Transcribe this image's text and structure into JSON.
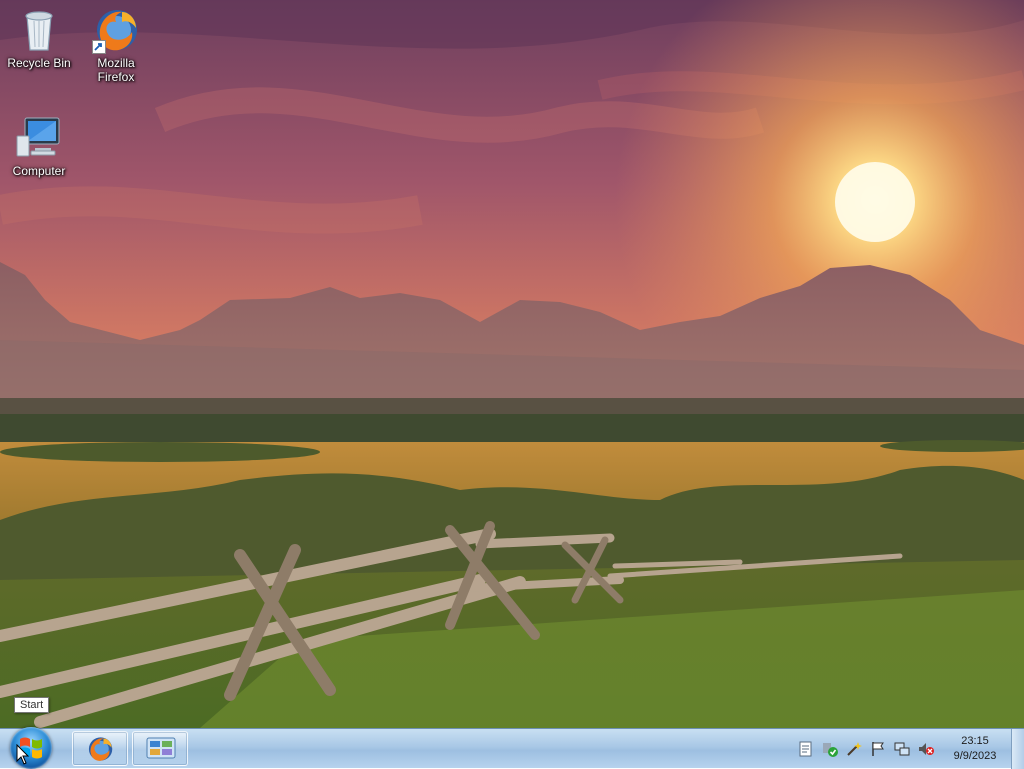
{
  "desktop": {
    "icons": [
      {
        "label": "Recycle Bin"
      },
      {
        "label": "Mozilla Firefox"
      },
      {
        "label": "Computer"
      }
    ]
  },
  "tooltip": {
    "text": "Start"
  },
  "taskbar": {
    "start_icon": "windows-start-orb",
    "pinned": [
      {
        "icon": "firefox-icon"
      },
      {
        "icon": "control-panel-icon"
      }
    ],
    "tray_icons": [
      "document-icon",
      "security-check-icon",
      "wand-icon",
      "flag-icon",
      "network-icon",
      "volume-muted-icon"
    ],
    "clock": {
      "time": "23:15",
      "date": "9/9/2023"
    }
  },
  "colors": {
    "sky_top": "#7a4a62",
    "sky_glow": "#f2a35a",
    "taskbar": "#a9c8e6"
  }
}
